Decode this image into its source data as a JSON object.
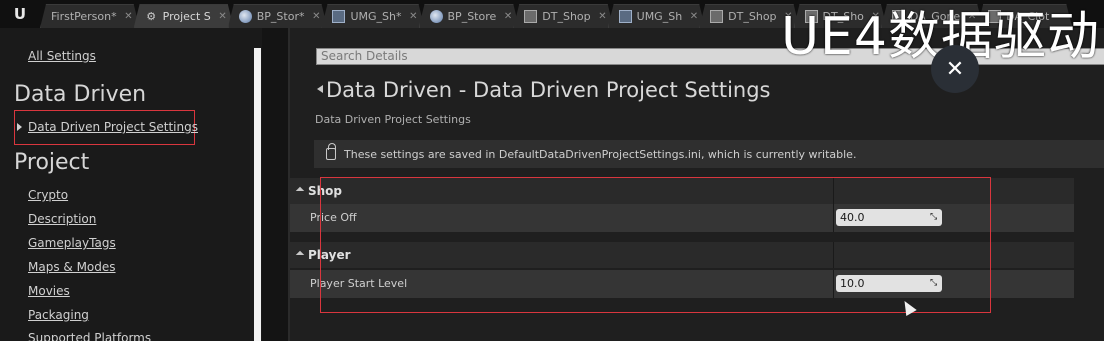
{
  "tabs": [
    {
      "label": "FirstPerson*",
      "icon": "",
      "active": false
    },
    {
      "label": "Project S",
      "icon": "project-settings-icon",
      "active": true
    },
    {
      "label": "BP_Stor*",
      "icon": "blueprint-icon",
      "active": false
    },
    {
      "label": "UMG_Sh*",
      "icon": "widget-icon",
      "active": false
    },
    {
      "label": "BP_Store",
      "icon": "blueprint-icon",
      "active": false
    },
    {
      "label": "DT_Shop",
      "icon": "datatable-icon",
      "active": false
    },
    {
      "label": "UMG_Sh",
      "icon": "widget-icon",
      "active": false
    },
    {
      "label": "DT_Shop",
      "icon": "datatable-icon",
      "active": false
    },
    {
      "label": "DT_Sho",
      "icon": "datatable-icon",
      "active": false
    },
    {
      "label": "DA_Gone",
      "icon": "dataasset-icon",
      "active": false
    },
    {
      "label": "DA_Clot",
      "icon": "dataasset-icon",
      "active": false
    }
  ],
  "watermark": "UE4数据驱动",
  "sidebar": {
    "all_settings": "All Settings",
    "category_data_driven": "Data Driven",
    "selected_item": "Data Driven Project Settings",
    "category_project": "Project",
    "project_items": [
      "Crypto",
      "Description",
      "GameplayTags",
      "Maps & Modes",
      "Movies",
      "Packaging",
      "Supported Platforms"
    ]
  },
  "details": {
    "search_placeholder": "Search Details",
    "title": "Data Driven - Data Driven Project Settings",
    "subtitle": "Data Driven Project Settings",
    "notice": "These settings are saved in DefaultDataDrivenProjectSettings.ini, which is currently writable.",
    "sections": [
      {
        "name": "Shop",
        "items": [
          {
            "label": "Price Off",
            "value": "40.0"
          }
        ]
      },
      {
        "name": "Player",
        "items": [
          {
            "label": "Player Start Level",
            "value": "10.0"
          }
        ]
      }
    ]
  }
}
